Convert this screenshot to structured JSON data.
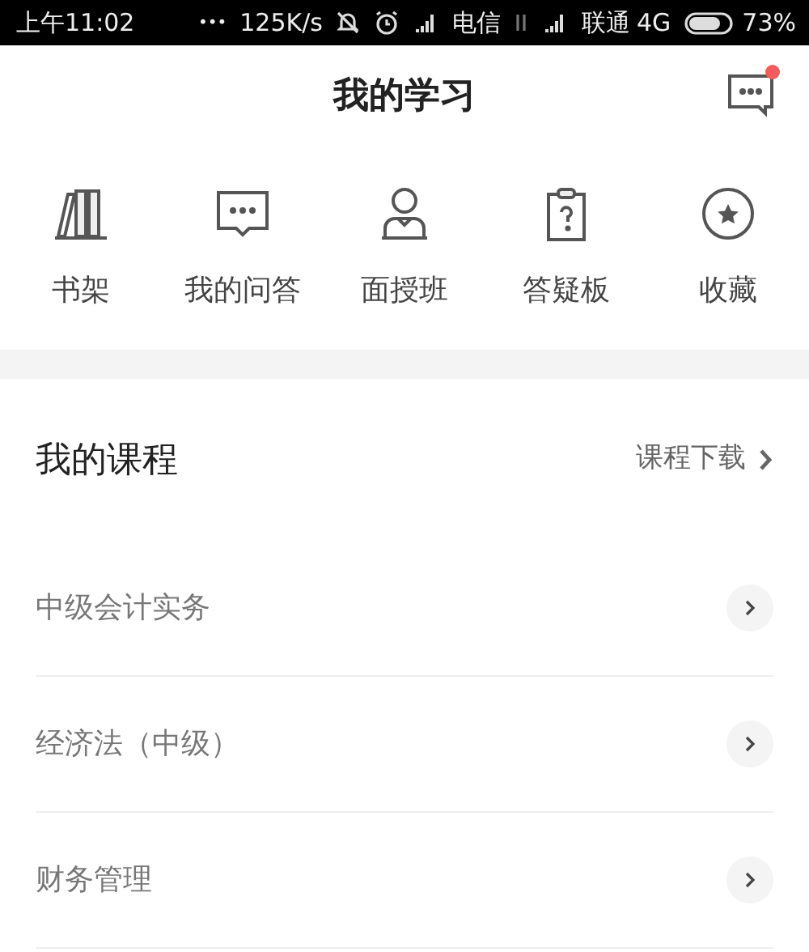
{
  "status_bar": {
    "time": "上午11:02",
    "more": "•••",
    "speed": "125K/s",
    "carrier_1": "电信",
    "carrier_2": "联通",
    "network": "4G",
    "battery": "73%"
  },
  "header": {
    "title": "我的学习",
    "message_unread": true
  },
  "shortcuts": [
    {
      "kind": "bookshelf",
      "label": "书架"
    },
    {
      "kind": "chat",
      "label": "我的问答"
    },
    {
      "kind": "person",
      "label": "面授班"
    },
    {
      "kind": "clipboard",
      "label": "答疑板"
    },
    {
      "kind": "star",
      "label": "收藏"
    }
  ],
  "courses": {
    "title": "我的课程",
    "download": "课程下载",
    "items": [
      {
        "label": "中级会计实务"
      },
      {
        "label": "经济法（中级）"
      },
      {
        "label": "财务管理"
      }
    ]
  }
}
